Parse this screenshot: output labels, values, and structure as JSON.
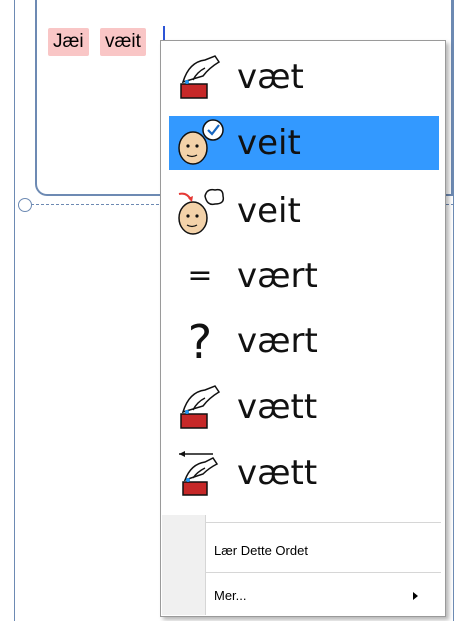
{
  "document": {
    "words": [
      "Jæi",
      "væit"
    ]
  },
  "context_menu": {
    "suggestions": [
      {
        "text": "væt",
        "icon": "pour-water-icon",
        "selected": false
      },
      {
        "text": "veit",
        "icon": "know-head-check-icon",
        "selected": true
      },
      {
        "text": "veit",
        "icon": "know-head-arrow-icon",
        "selected": false
      },
      {
        "text": "vært",
        "icon": "equals-icon",
        "symbol": "=",
        "selected": false
      },
      {
        "text": "vært",
        "icon": "question-mark-icon",
        "symbol": "?",
        "selected": false
      },
      {
        "text": "vætt",
        "icon": "pour-water-icon",
        "selected": false
      },
      {
        "text": "vætt",
        "icon": "pour-water-past-icon",
        "selected": false
      }
    ],
    "learn_word_label": "Lær Dette Ordet",
    "more_label": "Mer..."
  },
  "colors": {
    "selection": "#3399ff",
    "word_highlight": "#f9c6c6",
    "frame_border": "#6d8ab3",
    "caret": "#2d55d6"
  }
}
